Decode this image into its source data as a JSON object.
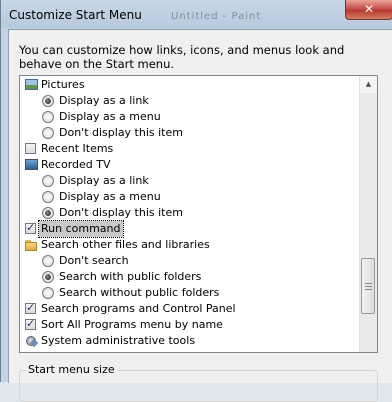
{
  "window": {
    "title": "Customize Start Menu",
    "close_label": "✕",
    "background_title": "Untitled - Paint"
  },
  "description": "You can customize how links, icons, and menus look and behave on the Start menu.",
  "items": [
    {
      "kind": "header",
      "icon": "pictures-icon",
      "label": "Pictures"
    },
    {
      "kind": "radio",
      "label": "Display as a link",
      "checked": true
    },
    {
      "kind": "radio",
      "label": "Display as a menu",
      "checked": false
    },
    {
      "kind": "radio",
      "label": "Don't display this item",
      "checked": false
    },
    {
      "kind": "check",
      "label": "Recent Items",
      "checked": false
    },
    {
      "kind": "header",
      "icon": "recorded-tv-icon",
      "label": "Recorded TV"
    },
    {
      "kind": "radio",
      "label": "Display as a link",
      "checked": false
    },
    {
      "kind": "radio",
      "label": "Display as a menu",
      "checked": false
    },
    {
      "kind": "radio",
      "label": "Don't display this item",
      "checked": true
    },
    {
      "kind": "check",
      "label": "Run command",
      "checked": true,
      "selected": true
    },
    {
      "kind": "header",
      "icon": "folder-search-icon",
      "label": "Search other files and libraries"
    },
    {
      "kind": "radio",
      "label": "Don't search",
      "checked": false
    },
    {
      "kind": "radio",
      "label": "Search with public folders",
      "checked": true
    },
    {
      "kind": "radio",
      "label": "Search without public folders",
      "checked": false
    },
    {
      "kind": "check",
      "label": "Search programs and Control Panel",
      "checked": true
    },
    {
      "kind": "check",
      "label": "Sort All Programs menu by name",
      "checked": true
    },
    {
      "kind": "header",
      "icon": "admin-tools-icon",
      "label": "System administrative tools"
    }
  ],
  "start_menu_size": {
    "title": "Start menu size"
  }
}
